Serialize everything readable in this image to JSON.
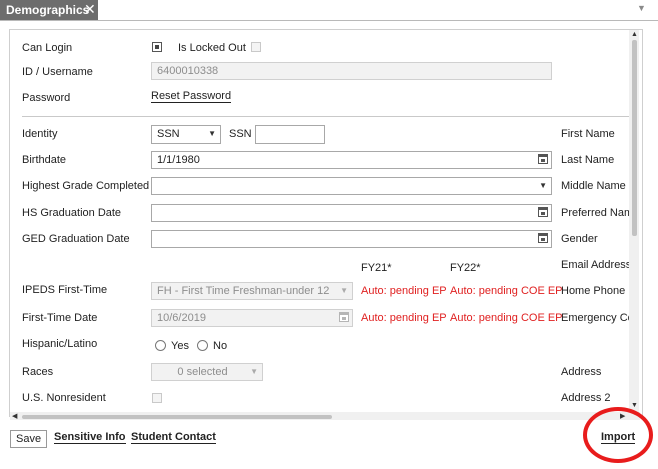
{
  "tab": {
    "label": "Demographics",
    "close": "✕",
    "menu": "▼"
  },
  "top": {
    "can_login": "Can Login",
    "can_login_checked": true,
    "is_locked_out": "Is Locked Out",
    "is_locked_out_checked": false,
    "id_username_label": "ID / Username",
    "id_username_value": "6400010338",
    "password_label": "Password",
    "reset_password": "Reset Password"
  },
  "form": {
    "identity_label": "Identity",
    "identity_value": "SSN",
    "ssn_label": "SSN",
    "ssn_value": "",
    "birthdate_label": "Birthdate",
    "birthdate_value": "1/1/1980",
    "highest_grade_label": "Highest Grade Completed",
    "highest_grade_value": "",
    "hs_grad_label": "HS Graduation Date",
    "hs_grad_value": "",
    "ged_grad_label": "GED Graduation Date",
    "ged_grad_value": "",
    "fy21_header": "FY21*",
    "fy22_header": "FY22*",
    "ipeds_label": "IPEDS First-Time",
    "ipeds_value": "FH - First Time Freshman-under 12",
    "ipeds_fy21": "Auto: pending EP",
    "ipeds_fy22": "Auto: pending COE EP",
    "first_time_date_label": "First-Time Date",
    "first_time_date_value": "10/6/2019",
    "ftd_fy21": "Auto: pending EP",
    "ftd_fy22": "Auto: pending COE EP",
    "hispanic_label": "Hispanic/Latino",
    "hispanic_yes": "Yes",
    "hispanic_no": "No",
    "races_label": "Races",
    "races_value": "0 selected",
    "us_nonresident_label": "U.S. Nonresident",
    "us_nonresident_checked": false
  },
  "right_column": {
    "first_name": "First Name",
    "last_name": "Last Name",
    "middle_name": "Middle Name",
    "preferred_name": "Preferred Nam",
    "gender": "Gender",
    "email_address": "Email Address",
    "home_phone": "Home Phone",
    "emergency_contact": "Emergency Cor",
    "address": "Address",
    "address_2": "Address 2"
  },
  "footer": {
    "save": "Save",
    "sensitive_info": "Sensitive Info",
    "student_contact": "Student Contact",
    "import": "Import"
  },
  "colors": {
    "tab_bg": "#6d6d6d",
    "auto_pending": "#e02020",
    "highlight_ring": "#e81c1c"
  }
}
